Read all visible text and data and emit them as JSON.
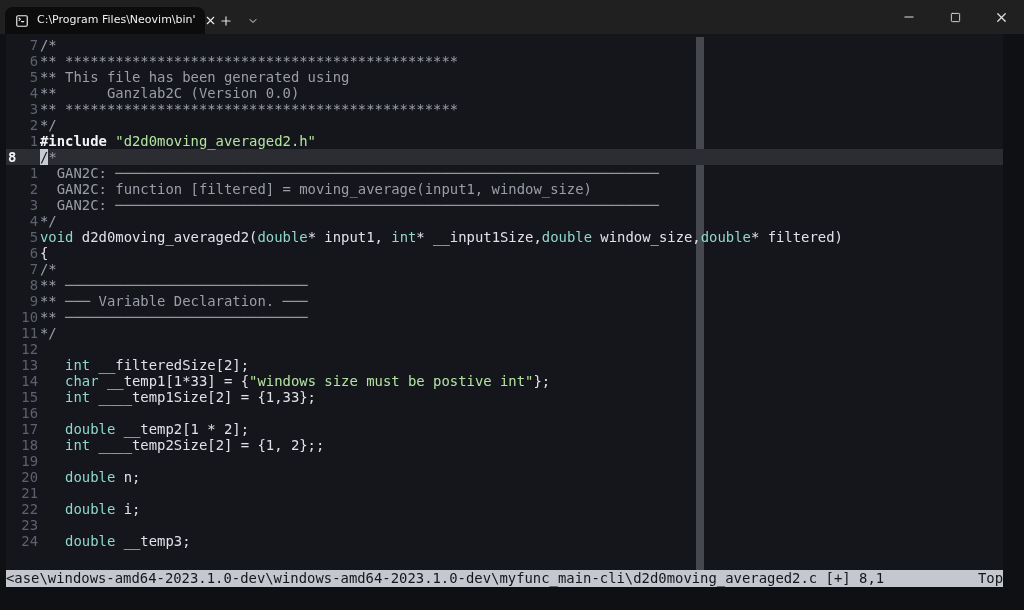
{
  "window": {
    "title": "C:\\Program Files\\Neovim\\bin'"
  },
  "editor": {
    "lines": [
      {
        "number": "7",
        "current": false,
        "tokens": [
          {
            "kind": "comment",
            "text": "/*"
          }
        ]
      },
      {
        "number": "6",
        "current": false,
        "tokens": [
          {
            "kind": "comment",
            "text": "** ***********************************************"
          }
        ]
      },
      {
        "number": "5",
        "current": false,
        "tokens": [
          {
            "kind": "comment",
            "text": "** This file has been generated using"
          }
        ]
      },
      {
        "number": "4",
        "current": false,
        "tokens": [
          {
            "kind": "comment",
            "text": "**      Ganzlab2C (Version 0.0)"
          }
        ]
      },
      {
        "number": "3",
        "current": false,
        "tokens": [
          {
            "kind": "comment",
            "text": "** ***********************************************"
          }
        ]
      },
      {
        "number": "2",
        "current": false,
        "tokens": [
          {
            "kind": "comment",
            "text": "*/"
          }
        ]
      },
      {
        "number": "1",
        "current": false,
        "tokens": [
          {
            "kind": "preproc",
            "text": "#include"
          },
          {
            "kind": "string",
            "text": " \"d2d0moving_averaged2.h\""
          }
        ]
      },
      {
        "number": "8",
        "current": true,
        "tokens": [
          {
            "kind": "cursor",
            "text": "/"
          },
          {
            "kind": "comment",
            "text": "*"
          }
        ]
      },
      {
        "number": "1",
        "current": false,
        "tokens": [
          {
            "kind": "comment",
            "text": "  GAN2C: ─────────────────────────────────────────────────────────────────"
          }
        ]
      },
      {
        "number": "2",
        "current": false,
        "tokens": [
          {
            "kind": "comment",
            "text": "  GAN2C: function [filtered] = moving_average(input1, window_size)"
          }
        ]
      },
      {
        "number": "3",
        "current": false,
        "tokens": [
          {
            "kind": "comment",
            "text": "  GAN2C: ─────────────────────────────────────────────────────────────────"
          }
        ]
      },
      {
        "number": "4",
        "current": false,
        "tokens": [
          {
            "kind": "comment",
            "text": "*/"
          }
        ]
      },
      {
        "number": "5",
        "current": false,
        "tokens": [
          {
            "kind": "type",
            "text": "void"
          },
          {
            "kind": "plain",
            "text": " d2d0moving_averaged2("
          },
          {
            "kind": "type",
            "text": "double"
          },
          {
            "kind": "plain",
            "text": "* input1, "
          },
          {
            "kind": "type",
            "text": "int"
          },
          {
            "kind": "plain",
            "text": "* __input1Size,"
          },
          {
            "kind": "type",
            "text": "double"
          },
          {
            "kind": "plain",
            "text": " window_size,"
          },
          {
            "kind": "type",
            "text": "double"
          },
          {
            "kind": "plain",
            "text": "* filtered)"
          }
        ]
      },
      {
        "number": "6",
        "current": false,
        "tokens": [
          {
            "kind": "plain",
            "text": "{"
          }
        ]
      },
      {
        "number": "7",
        "current": false,
        "tokens": [
          {
            "kind": "comment",
            "text": "/*"
          }
        ]
      },
      {
        "number": "8",
        "current": false,
        "tokens": [
          {
            "kind": "comment",
            "text": "** ─────────────────────────────"
          }
        ]
      },
      {
        "number": "9",
        "current": false,
        "tokens": [
          {
            "kind": "comment",
            "text": "** ─── Variable Declaration. ───"
          }
        ]
      },
      {
        "number": "10",
        "current": false,
        "tokens": [
          {
            "kind": "comment",
            "text": "** ─────────────────────────────"
          }
        ]
      },
      {
        "number": "11",
        "current": false,
        "tokens": [
          {
            "kind": "comment",
            "text": "*/"
          }
        ]
      },
      {
        "number": "12",
        "current": false
      },
      {
        "number": "13",
        "current": false,
        "tokens": [
          {
            "kind": "type",
            "text": "   int"
          },
          {
            "kind": "plain",
            "text": " __filteredSize[2];"
          }
        ]
      },
      {
        "number": "14",
        "current": false,
        "tokens": [
          {
            "kind": "type",
            "text": "   char"
          },
          {
            "kind": "plain",
            "text": " __temp1[1*33] = {"
          },
          {
            "kind": "string",
            "text": "\"windows size must be postive int\""
          },
          {
            "kind": "plain",
            "text": "};"
          }
        ]
      },
      {
        "number": "15",
        "current": false,
        "tokens": [
          {
            "kind": "type",
            "text": "   int"
          },
          {
            "kind": "plain",
            "text": " ____temp1Size[2] = {1,33};"
          }
        ]
      },
      {
        "number": "16",
        "current": false
      },
      {
        "number": "17",
        "current": false,
        "tokens": [
          {
            "kind": "type",
            "text": "   double"
          },
          {
            "kind": "plain",
            "text": " __temp2[1 * 2];"
          }
        ]
      },
      {
        "number": "18",
        "current": false,
        "tokens": [
          {
            "kind": "type",
            "text": "   int"
          },
          {
            "kind": "plain",
            "text": " ____temp2Size[2] = {1, 2};;"
          }
        ]
      },
      {
        "number": "19",
        "current": false
      },
      {
        "number": "20",
        "current": false,
        "tokens": [
          {
            "kind": "type",
            "text": "   double"
          },
          {
            "kind": "plain",
            "text": " n;"
          }
        ]
      },
      {
        "number": "21",
        "current": false
      },
      {
        "number": "22",
        "current": false,
        "tokens": [
          {
            "kind": "type",
            "text": "   double"
          },
          {
            "kind": "plain",
            "text": " i;"
          }
        ]
      },
      {
        "number": "23",
        "current": false
      },
      {
        "number": "24",
        "current": false,
        "tokens": [
          {
            "kind": "type",
            "text": "   double"
          },
          {
            "kind": "plain",
            "text": " __temp3;"
          }
        ]
      }
    ]
  },
  "status_line": {
    "file": "<ase\\windows-amd64-2023.1.0-dev\\windows-amd64-2023.1.0-dev\\myfunc_main-cli\\d2d0moving_averaged2.c [+] 8,1",
    "scroll": "Top"
  }
}
